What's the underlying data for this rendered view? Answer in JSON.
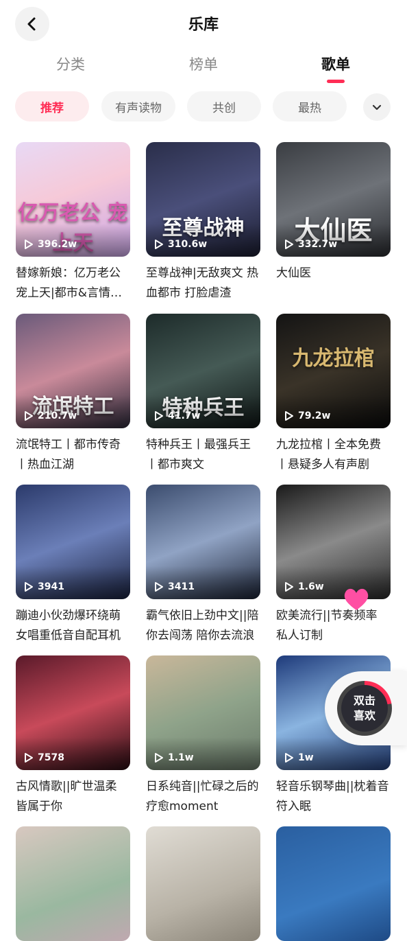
{
  "header": {
    "title": "乐库"
  },
  "tabs": [
    {
      "label": "分类",
      "active": false
    },
    {
      "label": "榜单",
      "active": false
    },
    {
      "label": "歌单",
      "active": true
    }
  ],
  "chips": [
    {
      "label": "推荐",
      "active": true
    },
    {
      "label": "有声读物",
      "active": false
    },
    {
      "label": "共创",
      "active": false
    },
    {
      "label": "最热",
      "active": false
    }
  ],
  "playlists": [
    {
      "title": "替嫁新娘：亿万老公宠上天|都市&言情&...",
      "plays": "396.2w",
      "cover_text": "亿万老公 宠上天"
    },
    {
      "title": "至尊战神|无敌爽文 热血都市 打脸虐渣",
      "plays": "310.6w",
      "cover_text": "至尊战神"
    },
    {
      "title": "大仙医",
      "plays": "332.7w",
      "cover_text": "大仙医"
    },
    {
      "title": "流氓特工丨都市传奇丨热血江湖",
      "plays": "210.7w",
      "cover_text": "流氓特工"
    },
    {
      "title": "特种兵王丨最强兵王丨都市爽文",
      "plays": "41.7w",
      "cover_text": "特种兵王"
    },
    {
      "title": "九龙拉棺丨全本免费丨悬疑多人有声剧",
      "plays": "79.2w",
      "cover_text": "九龙拉棺"
    },
    {
      "title": "蹦迪小伙劲爆环绕萌女唱重低音自配耳机",
      "plays": "3941",
      "cover_text": ""
    },
    {
      "title": "霸气依旧上劲中文||陪你去闯荡 陪你去流浪",
      "plays": "3411",
      "cover_text": ""
    },
    {
      "title": "欧美流行||节奏频率 私人订制",
      "plays": "1.6w",
      "cover_text": ""
    },
    {
      "title": "古风情歌||旷世温柔 皆属于你",
      "plays": "7578",
      "cover_text": ""
    },
    {
      "title": "日系纯音||忙碌之后的疗愈moment",
      "plays": "1.1w",
      "cover_text": ""
    },
    {
      "title": "轻音乐钢琴曲||枕着音符入眠",
      "plays": "1w",
      "cover_text": ""
    },
    {
      "title": "",
      "plays": "",
      "cover_text": ""
    },
    {
      "title": "",
      "plays": "",
      "cover_text": ""
    },
    {
      "title": "",
      "plays": "",
      "cover_text": ""
    }
  ],
  "floating_like": {
    "line1": "双击",
    "line2": "喜欢"
  },
  "colors": {
    "accent": "#ff2d55"
  },
  "icons": {
    "back": "chevron-left-icon",
    "more": "chevron-down-icon",
    "play": "play-icon",
    "heart": "heart-icon"
  }
}
